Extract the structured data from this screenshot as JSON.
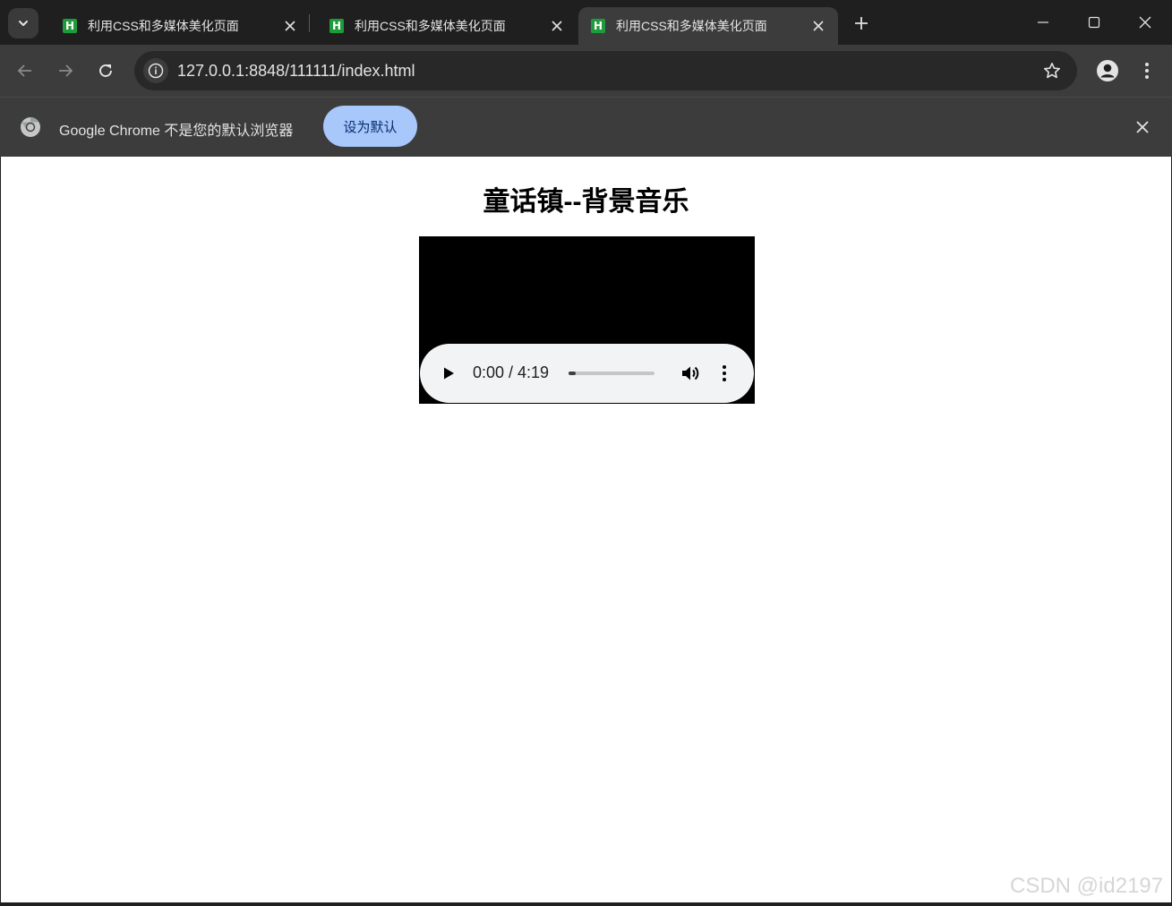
{
  "tabs": [
    {
      "title": "利用CSS和多媒体美化页面",
      "favicon": "H",
      "active": false
    },
    {
      "title": "利用CSS和多媒体美化页面",
      "favicon": "H",
      "active": false
    },
    {
      "title": "利用CSS和多媒体美化页面",
      "favicon": "H",
      "active": true
    }
  ],
  "toolbar": {
    "url": "127.0.0.1:8848/111111/index.html"
  },
  "infobar": {
    "message": "Google Chrome 不是您的默认浏览器",
    "button_label": "设为默认"
  },
  "page": {
    "title": "童话镇--背景音乐",
    "audio": {
      "time": "0:00 / 4:19",
      "progress_percent": 8
    }
  },
  "watermark": "CSDN @id2197",
  "colors": {
    "chrome_dark": "#1f1f1f",
    "toolbar": "#3c3c3c",
    "accent_button": "#a8c7fa",
    "favicon": "#1e9b3a",
    "audio_bg": "#f1f3f4"
  },
  "icons": [
    "tab-search-icon",
    "favicon-icon",
    "close-icon",
    "plus-icon",
    "minimize-icon",
    "maximize-icon",
    "back-icon",
    "forward-icon",
    "reload-icon",
    "info-icon",
    "star-icon",
    "profile-icon",
    "kebab-icon",
    "chrome-logo-icon",
    "play-icon",
    "volume-icon"
  ]
}
